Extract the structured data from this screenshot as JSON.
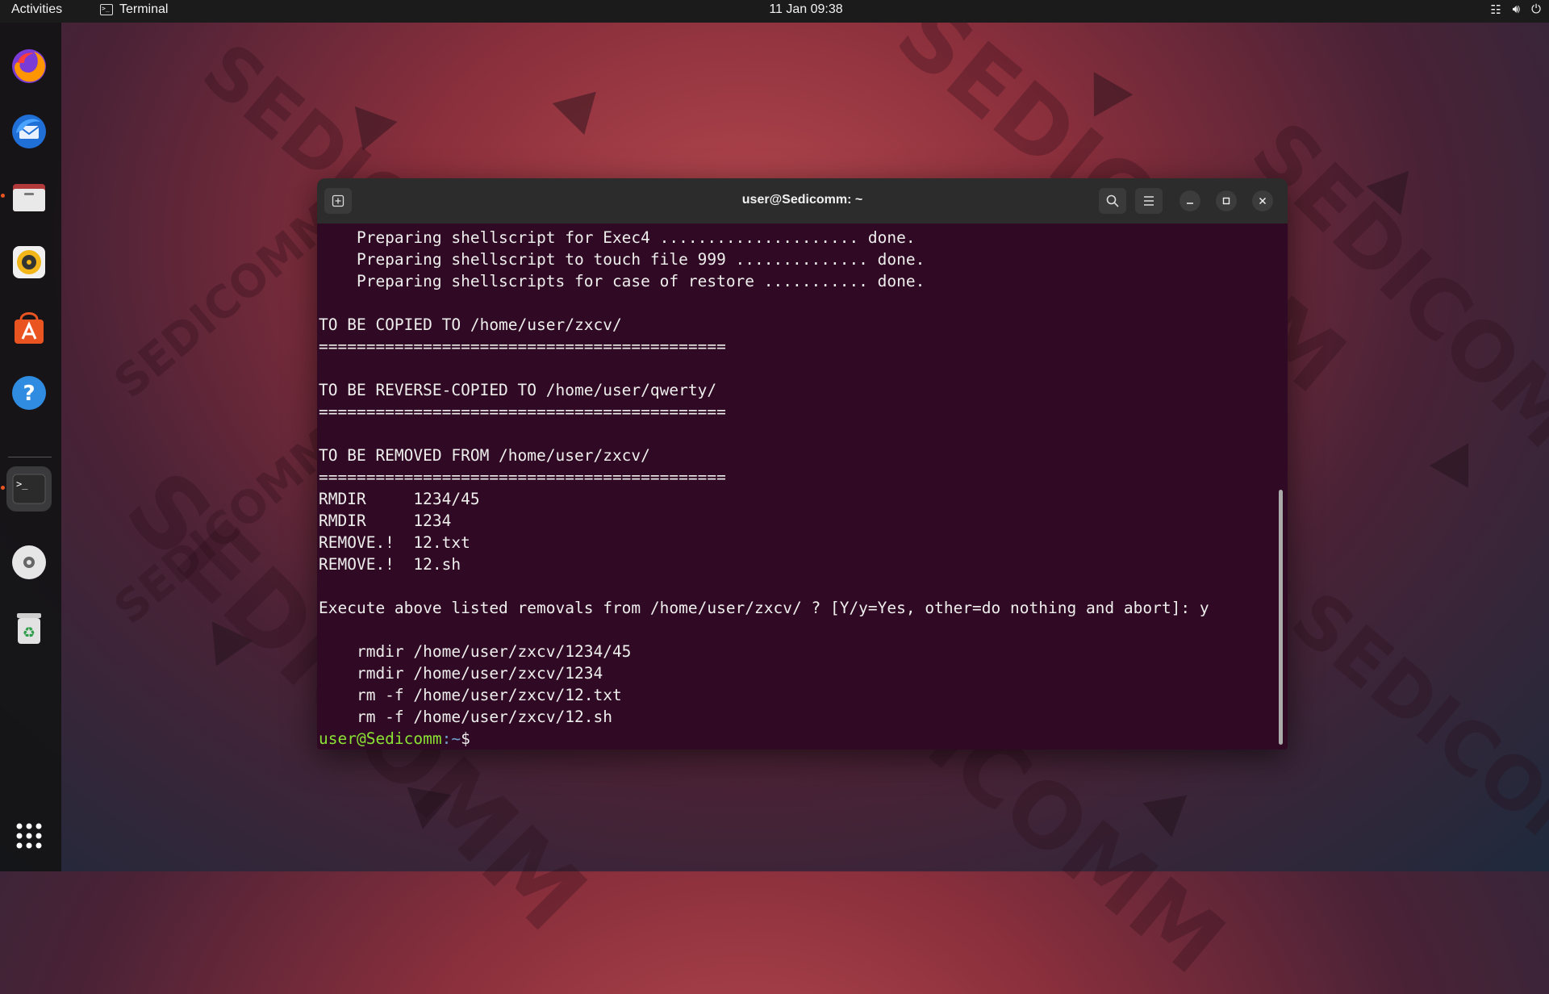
{
  "topbar": {
    "activities": "Activities",
    "app_name": "Terminal",
    "clock": "11 Jan  09:38",
    "tray_icons": [
      "network-icon",
      "volume-icon",
      "power-icon"
    ]
  },
  "dock": {
    "apps": [
      "Firefox",
      "Thunderbird",
      "Files",
      "Rhythmbox",
      "Ubuntu Software",
      "Help",
      "Terminal",
      "Disc",
      "Trash",
      "Show Applications"
    ]
  },
  "window": {
    "title": "user@Sedicomm: ~"
  },
  "terminal": {
    "lines": [
      "    Preparing shellscript for Exec4 ..................... done.",
      "    Preparing shellscript to touch file 999 .............. done.",
      "    Preparing shellscripts for case of restore ........... done.",
      "",
      "TO BE COPIED TO /home/user/zxcv/",
      "===========================================",
      "",
      "TO BE REVERSE-COPIED TO /home/user/qwerty/",
      "===========================================",
      "",
      "TO BE REMOVED FROM /home/user/zxcv/",
      "===========================================",
      "RMDIR     1234/45",
      "RMDIR     1234",
      "REMOVE.!  12.txt",
      "REMOVE.!  12.sh",
      "",
      "Execute above listed removals from /home/user/zxcv/ ? [Y/y=Yes, other=do nothing and abort]: y",
      "",
      "    rmdir /home/user/zxcv/1234/45",
      "    rmdir /home/user/zxcv/1234",
      "    rm -f /home/user/zxcv/12.txt",
      "    rm -f /home/user/zxcv/12.sh"
    ],
    "prompt_user": "user@Sedicomm",
    "prompt_sep": ":",
    "prompt_path": "~",
    "prompt_symbol": "$"
  },
  "wallpaper": {
    "watermark": "SEDICOMM"
  },
  "colors": {
    "terminal_bg": "#300a24",
    "terminal_fg": "#eeeeec",
    "prompt_user": "#8ae234",
    "prompt_path": "#729fcf",
    "accent": "#e95420"
  }
}
